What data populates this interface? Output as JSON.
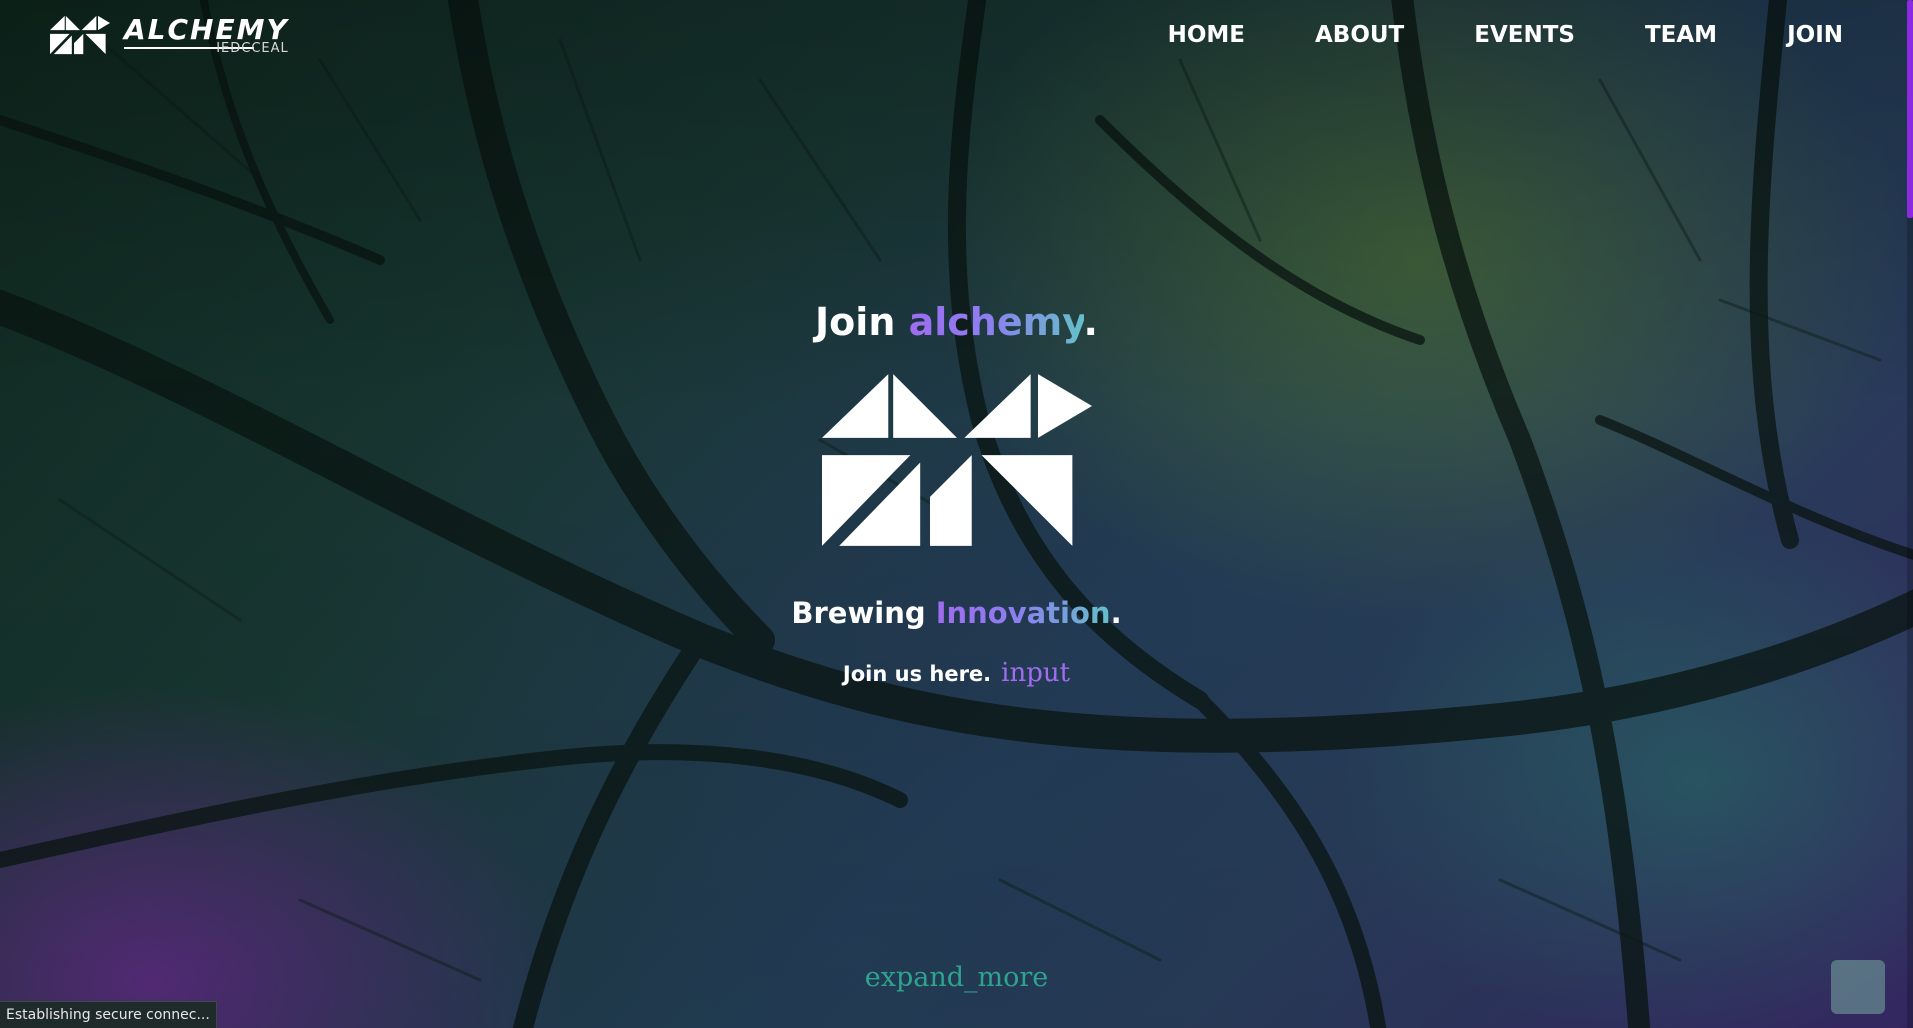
{
  "brand": {
    "name": "ALCHEMY",
    "subname": "IEDCCEAL"
  },
  "nav": {
    "items": [
      "HOME",
      "ABOUT",
      "EVENTS",
      "TEAM",
      "JOIN"
    ]
  },
  "hero": {
    "title_prefix": "Join ",
    "title_highlight": "alchemy",
    "title_suffix": ".",
    "tagline_prefix": "Brewing ",
    "tagline_highlight": "Innovation",
    "tagline_suffix": ".",
    "join_label": "Join us here.",
    "join_link": "input"
  },
  "scroll_indicator": "expand_more",
  "status_bar": "Establishing secure connec...",
  "colors": {
    "accent_purple": "#a26cf0",
    "accent_teal": "#63c0c9",
    "scrollbar": "#8a2be2"
  },
  "icons": {
    "logo": "alchemy-triangles-logo",
    "scroll_top": "scroll-to-top-button"
  }
}
